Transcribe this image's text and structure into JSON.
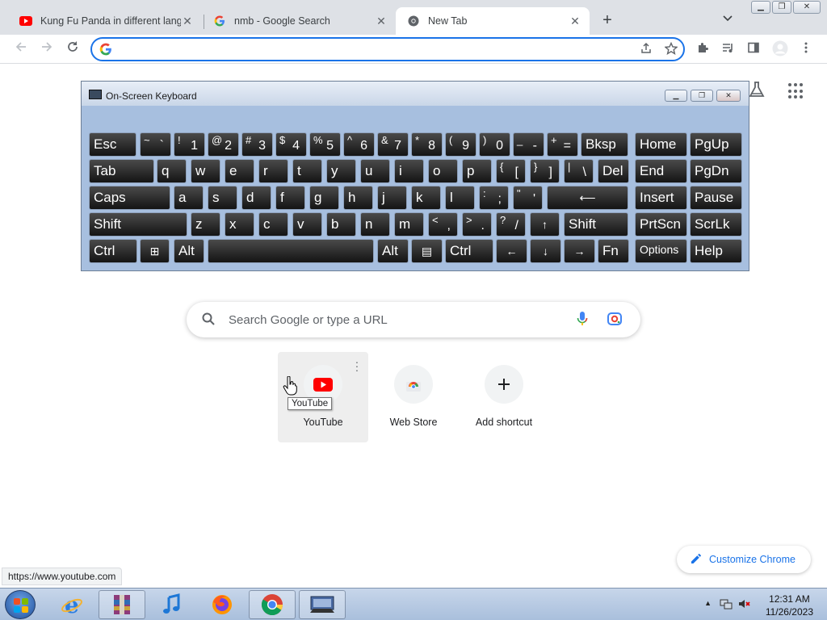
{
  "browser": {
    "tabs": [
      {
        "title": "Kung Fu Panda in different langu",
        "favicon": "youtube-icon"
      },
      {
        "title": "nmb - Google Search",
        "favicon": "google-icon"
      },
      {
        "title": "New Tab",
        "favicon": "chrome-icon"
      }
    ],
    "new_tab_symbol": "+",
    "close_symbol": "✕",
    "omnibox": {
      "value": "",
      "placeholder": ""
    }
  },
  "ntp": {
    "search_placeholder": "Search Google or type a URL",
    "shortcuts": [
      {
        "label": "YouTube",
        "icon": "youtube-icon"
      },
      {
        "label": "Web Store",
        "icon": "webstore-icon"
      },
      {
        "label": "Add shortcut",
        "icon": "plus-icon"
      }
    ],
    "tooltip": "YouTube",
    "customize_label": "Customize Chrome",
    "status_url": "https://www.youtube.com"
  },
  "osk": {
    "title": "On-Screen Keyboard",
    "row1": [
      "Esc",
      "~`",
      "!1",
      "@2",
      "#3",
      "$4",
      "%5",
      "^6",
      "&7",
      "*8",
      "(9",
      ")0",
      "_-",
      "+=",
      "Bksp",
      "Home",
      "PgUp"
    ],
    "row2": [
      "Tab",
      "q",
      "w",
      "e",
      "r",
      "t",
      "y",
      "u",
      "i",
      "o",
      "p",
      "{[",
      "}]",
      "|\\",
      "Del",
      "End",
      "PgDn"
    ],
    "row3": [
      "Caps",
      "a",
      "s",
      "d",
      "f",
      "g",
      "h",
      "j",
      "k",
      "l",
      ":;",
      "\"'",
      "⟵",
      "Insert",
      "Pause"
    ],
    "row4": [
      "Shift",
      "z",
      "x",
      "c",
      "v",
      "b",
      "n",
      "m",
      "<,",
      ">.",
      "?/",
      "↑",
      "Shift",
      "PrtScn",
      "ScrLk"
    ],
    "row5": [
      "Ctrl",
      "⊞",
      "Alt",
      "",
      "Alt",
      "▤",
      "Ctrl",
      "←",
      "↓",
      "→",
      "Fn",
      "Options",
      "Help"
    ]
  },
  "taskbar": {
    "time": "12:31 AM",
    "date": "11/26/2023"
  }
}
